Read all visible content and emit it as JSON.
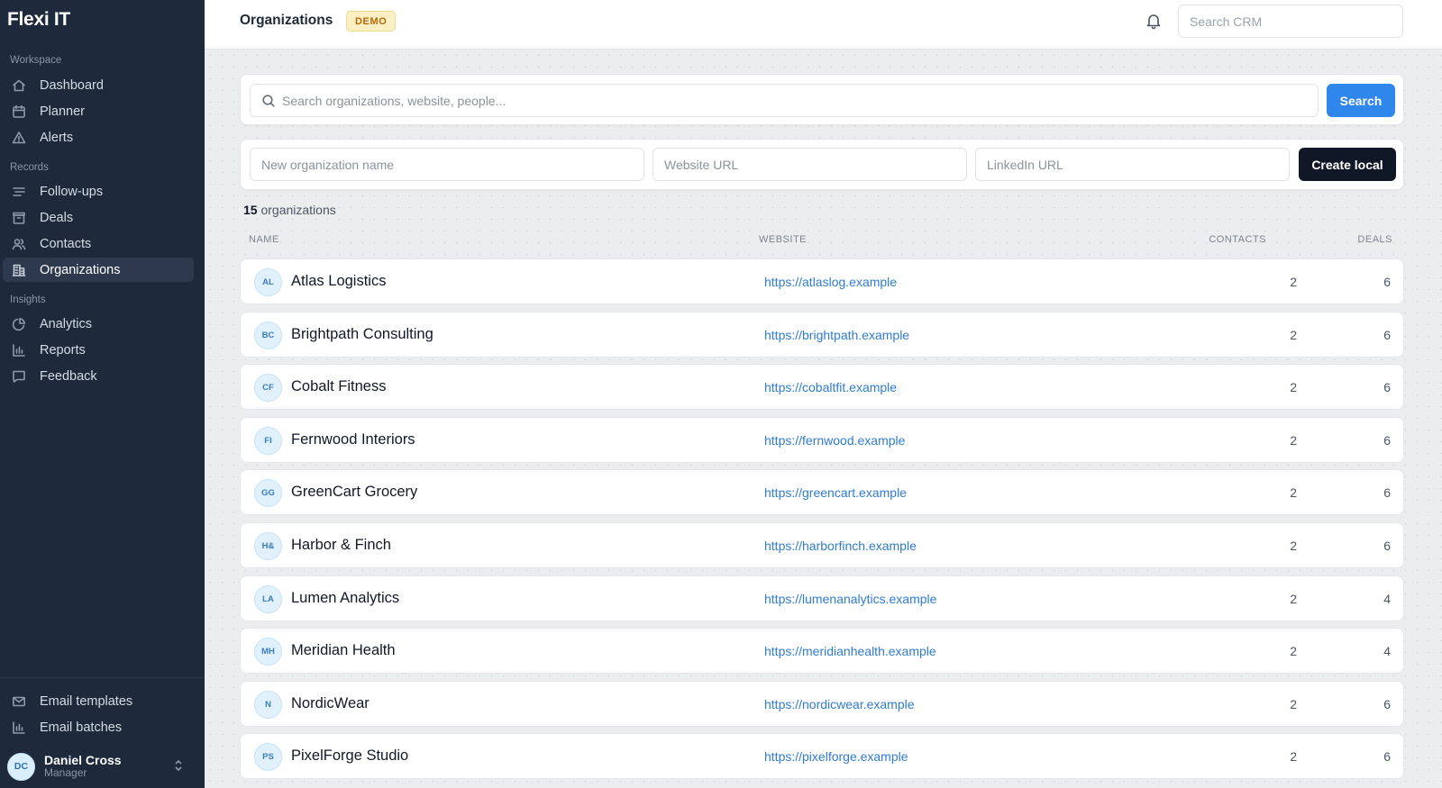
{
  "app": {
    "name": "Flexi IT"
  },
  "sidebar": {
    "sections": [
      {
        "label": "Workspace",
        "items": [
          {
            "label": "Dashboard",
            "icon": "home-icon"
          },
          {
            "label": "Planner",
            "icon": "calendar-icon"
          },
          {
            "label": "Alerts",
            "icon": "warning-icon"
          }
        ]
      },
      {
        "label": "Records",
        "items": [
          {
            "label": "Follow-ups",
            "icon": "list-filter-icon"
          },
          {
            "label": "Deals",
            "icon": "briefcase-icon"
          },
          {
            "label": "Contacts",
            "icon": "users-icon"
          },
          {
            "label": "Organizations",
            "icon": "building-icon",
            "active": true
          }
        ]
      },
      {
        "label": "Insights",
        "items": [
          {
            "label": "Analytics",
            "icon": "pie-chart-icon"
          },
          {
            "label": "Reports",
            "icon": "bar-chart-icon"
          },
          {
            "label": "Feedback",
            "icon": "message-icon"
          }
        ]
      }
    ],
    "bottom_items": [
      {
        "label": "Email templates",
        "icon": "mail-icon"
      },
      {
        "label": "Email batches",
        "icon": "bar-chart-icon"
      }
    ],
    "user": {
      "initials": "DC",
      "name": "Daniel Cross",
      "role": "Manager"
    }
  },
  "header": {
    "title": "Organizations",
    "badge": "DEMO",
    "search_placeholder": "Search CRM"
  },
  "search": {
    "placeholder": "Search organizations, website, people...",
    "button_label": "Search"
  },
  "create": {
    "name_placeholder": "New organization name",
    "website_placeholder": "Website URL",
    "linkedin_placeholder": "LinkedIn URL",
    "button_label": "Create local"
  },
  "results": {
    "count": "15",
    "count_label": "organizations"
  },
  "table": {
    "columns": {
      "name": "NAME",
      "website": "WEBSITE",
      "contacts": "CONTACTS",
      "deals": "DEALS"
    },
    "rows": [
      {
        "initials": "AL",
        "name": "Atlas Logistics",
        "website": "https://atlaslog.example",
        "contacts": "2",
        "deals": "6"
      },
      {
        "initials": "BC",
        "name": "Brightpath Consulting",
        "website": "https://brightpath.example",
        "contacts": "2",
        "deals": "6"
      },
      {
        "initials": "CF",
        "name": "Cobalt Fitness",
        "website": "https://cobaltfit.example",
        "contacts": "2",
        "deals": "6"
      },
      {
        "initials": "FI",
        "name": "Fernwood Interiors",
        "website": "https://fernwood.example",
        "contacts": "2",
        "deals": "6"
      },
      {
        "initials": "GG",
        "name": "GreenCart Grocery",
        "website": "https://greencart.example",
        "contacts": "2",
        "deals": "6"
      },
      {
        "initials": "H&",
        "name": "Harbor & Finch",
        "website": "https://harborfinch.example",
        "contacts": "2",
        "deals": "6"
      },
      {
        "initials": "LA",
        "name": "Lumen Analytics",
        "website": "https://lumenanalytics.example",
        "contacts": "2",
        "deals": "4"
      },
      {
        "initials": "MH",
        "name": "Meridian Health",
        "website": "https://meridianhealth.example",
        "contacts": "2",
        "deals": "4"
      },
      {
        "initials": "N",
        "name": "NordicWear",
        "website": "https://nordicwear.example",
        "contacts": "2",
        "deals": "6"
      },
      {
        "initials": "PS",
        "name": "PixelForge Studio",
        "website": "https://pixelforge.example",
        "contacts": "2",
        "deals": "6"
      }
    ]
  },
  "colors": {
    "sidebar_bg": "#1e2a3b",
    "accent": "#2f86eb",
    "primary_dark": "#101828",
    "link": "#2f7cd3",
    "badge_bg": "#fcefc4"
  }
}
